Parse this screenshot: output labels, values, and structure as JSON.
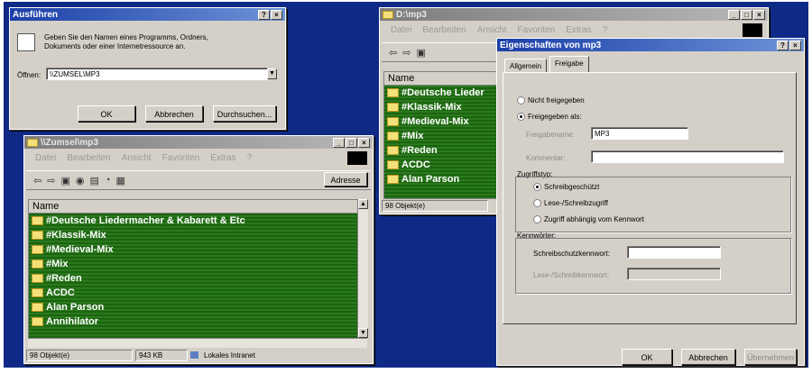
{
  "run_dialog": {
    "title": "Ausführen",
    "description_line1": "Geben Sie den Namen eines Programms, Ordners,",
    "description_line2": "Dokuments oder einer Internetressource an.",
    "open_label": "Öffnen:",
    "open_value": "\\\\ZUMSEL\\MP3",
    "ok": "OK",
    "cancel": "Abbrechen",
    "browse": "Durchsuchen..."
  },
  "explorer_left": {
    "title": "\\\\Zumsel\\mp3",
    "menu": [
      "Datei",
      "Bearbeiten",
      "Ansicht",
      "Favoriten",
      "Extras",
      "?"
    ],
    "address_label": "Adresse",
    "column_name": "Name",
    "items": [
      "#Deutsche Liedermacher & Kabarett & Etc",
      "#Klassik-Mix",
      "#Medieval-Mix",
      "#Mix",
      "#Reden",
      "ACDC",
      "Alan Parson",
      "Annihilator"
    ],
    "status_count": "98 Objekt(e)",
    "status_size": "943 KB",
    "status_zone": "Lokales Intranet"
  },
  "explorer_right": {
    "title": "D:\\mp3",
    "menu": [
      "Datei",
      "Bearbeiten",
      "Ansicht",
      "Favoriten",
      "Extras",
      "?"
    ],
    "column_name": "Name",
    "items": [
      "#Deutsche Lieder",
      "#Klassik-Mix",
      "#Medieval-Mix",
      "#Mix",
      "#Reden",
      "ACDC",
      "Alan Parson"
    ],
    "status_count": "98 Objekt(e)"
  },
  "properties_dialog": {
    "title": "Eigenschaften von mp3",
    "tabs": [
      "Allgemein",
      "Freigabe"
    ],
    "radio_not_shared": "Nicht freigegeben",
    "radio_shared_as": "Freigegeben als:",
    "share_name_label": "Freigabename:",
    "share_name_value": "MP3",
    "comment_label": "Kommentar:",
    "comment_value": "",
    "access_group": "Zugriffstyp:",
    "access_readonly": "Schreibgeschützt",
    "access_full": "Lese-/Schreibzugriff",
    "access_depends": "Zugriff abhängig vom Kennwort",
    "password_group": "Kennwörter:",
    "pw_readonly_label": "Schreibschutzkennwort:",
    "pw_full_label": "Lese-/Schreibkennwort:",
    "ok": "OK",
    "cancel": "Abbrechen",
    "apply": "Übernehmen"
  }
}
